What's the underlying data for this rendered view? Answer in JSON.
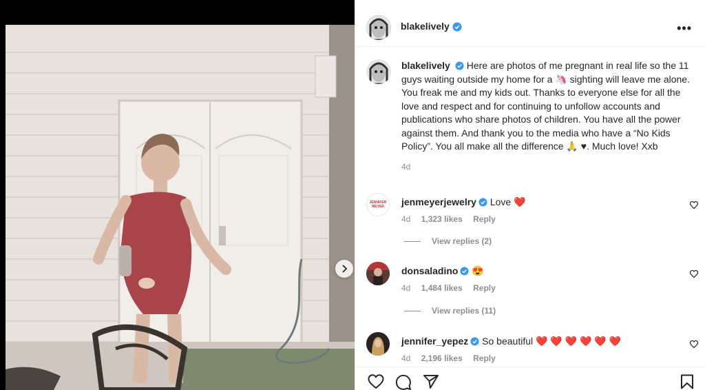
{
  "post": {
    "username": "blakelively",
    "more_label": "•••",
    "caption": "Here are photos of me pregnant in real life so the 11 guys waiting outside my home for a 🦄 sighting will leave me alone. You freak me and my kids out. Thanks to everyone else for all the love and respect and for continuing to unfollow accounts and publications who share photos of children. You have all the power against them. And thank you to the media who have a “No Kids Policy”. You all make all the difference 🙏 ♥. Much love! Xxb",
    "age": "4d"
  },
  "comments": [
    {
      "username": "jenmeyerjewelry",
      "text": "Love ❤️",
      "age": "4d",
      "likes": "1,323 likes",
      "reply": "Reply",
      "view_replies": "View replies (2)",
      "avatar_text": "JENNIFER MEYER"
    },
    {
      "username": "donsaladino",
      "text": "😍",
      "age": "4d",
      "likes": "1,484 likes",
      "reply": "Reply",
      "view_replies": "View replies (11)"
    },
    {
      "username": "jennifer_yepez",
      "text": "So beautiful ❤️ ❤️ ❤️ ❤️ ❤️ ❤️",
      "age": "4d",
      "likes": "2,196 likes",
      "reply": "Reply"
    }
  ],
  "icons": {
    "verified": "verified-badge-icon",
    "more": "more-options-icon",
    "like": "heart-outline-icon",
    "comment": "comment-bubble-icon",
    "share": "paper-plane-icon",
    "save": "bookmark-icon",
    "carousel_next": "chevron-right-icon"
  },
  "colors": {
    "verified": "#3897f0",
    "text": "#262626",
    "secondary": "#8e8e8e",
    "divider": "#efefef",
    "heart_red": "#ed4956"
  }
}
